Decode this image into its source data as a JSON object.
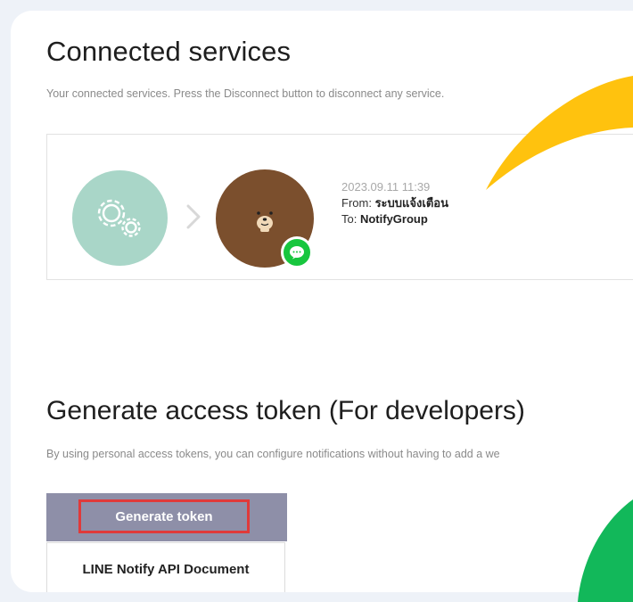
{
  "connected": {
    "title": "Connected services",
    "description": "Your connected services. Press the Disconnect button to disconnect any service.",
    "service": {
      "date": "2023.09.11 11:39",
      "from_label": "From: ",
      "from_value": "ระบบแจ้งเตือน",
      "to_label": "To: ",
      "to_value": "NotifyGroup"
    }
  },
  "generate": {
    "title": "Generate access token (For developers)",
    "description": "By using personal access tokens, you can configure notifications without having to add a we",
    "generate_button": "Generate token",
    "doc_button": "LINE Notify API Document"
  },
  "colors": {
    "page_bg": "#eef2f8",
    "service_circle": "#a9d6c8",
    "bear": "#7b4f2d",
    "line_green": "#17c63e",
    "generate_button": "#8e8fa8",
    "highlight_border": "#e03a3a",
    "deco_yellow": "#ffc20e",
    "deco_green": "#12b85a"
  },
  "icons": [
    "gears-icon",
    "chevron-right-icon",
    "bear-avatar-icon",
    "line-chat-icon"
  ]
}
